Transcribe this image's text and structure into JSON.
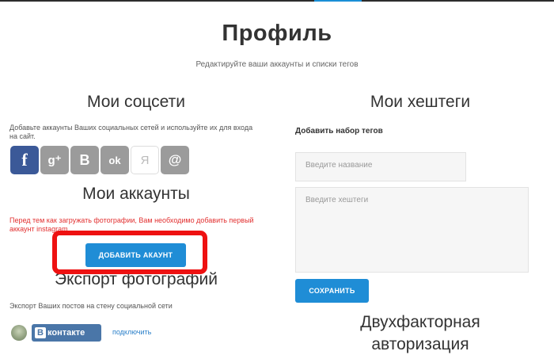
{
  "header": {
    "title": "Профиль",
    "subtitle": "Редактируйте ваши аккаунты и списки тегов"
  },
  "social": {
    "heading": "Мои соцсети",
    "description": "Добавьте аккаунты Ваших социальных сетей и используйте их для входа на сайт.",
    "networks": [
      {
        "name": "facebook",
        "glyph": "f",
        "color": "#3b5998"
      },
      {
        "name": "google-plus",
        "glyph": "g⁺",
        "color": "#9a9a9a"
      },
      {
        "name": "vkontakte",
        "glyph": "B",
        "color": "#9a9a9a"
      },
      {
        "name": "odnoklassniki",
        "glyph": "ok",
        "color": "#9a9a9a"
      },
      {
        "name": "yandex",
        "glyph": "Я",
        "color": "#ffffff"
      },
      {
        "name": "mail",
        "glyph": "@",
        "color": "#9a9a9a"
      }
    ]
  },
  "accounts": {
    "heading": "Мои аккаунты",
    "warning": "Перед тем как загружать фотографии, Вам необходимо добавить первый аккаунт instagram.",
    "add_button": "ДОБАВИТЬ АКАУНТ"
  },
  "export": {
    "heading": "Экспорт фотографий",
    "description": "Экспорт Ваших постов на стену социальной сети",
    "vk_logo_text": "контакте",
    "vk_logo_letter": "В",
    "connect_link": "подключить"
  },
  "hashtags": {
    "heading": "Мои хештеги",
    "add_set_label": "Добавить набор тегов",
    "name_placeholder": "Введите название",
    "tags_placeholder": "Введите хештеги",
    "save_button": "СОХРАНИТЬ"
  },
  "twofa": {
    "heading_line1": "Двухфакторная",
    "heading_line2": "авторизация"
  },
  "colors": {
    "accent": "#1f8dd6",
    "highlight": "#ee1111",
    "warning": "#e23030"
  }
}
